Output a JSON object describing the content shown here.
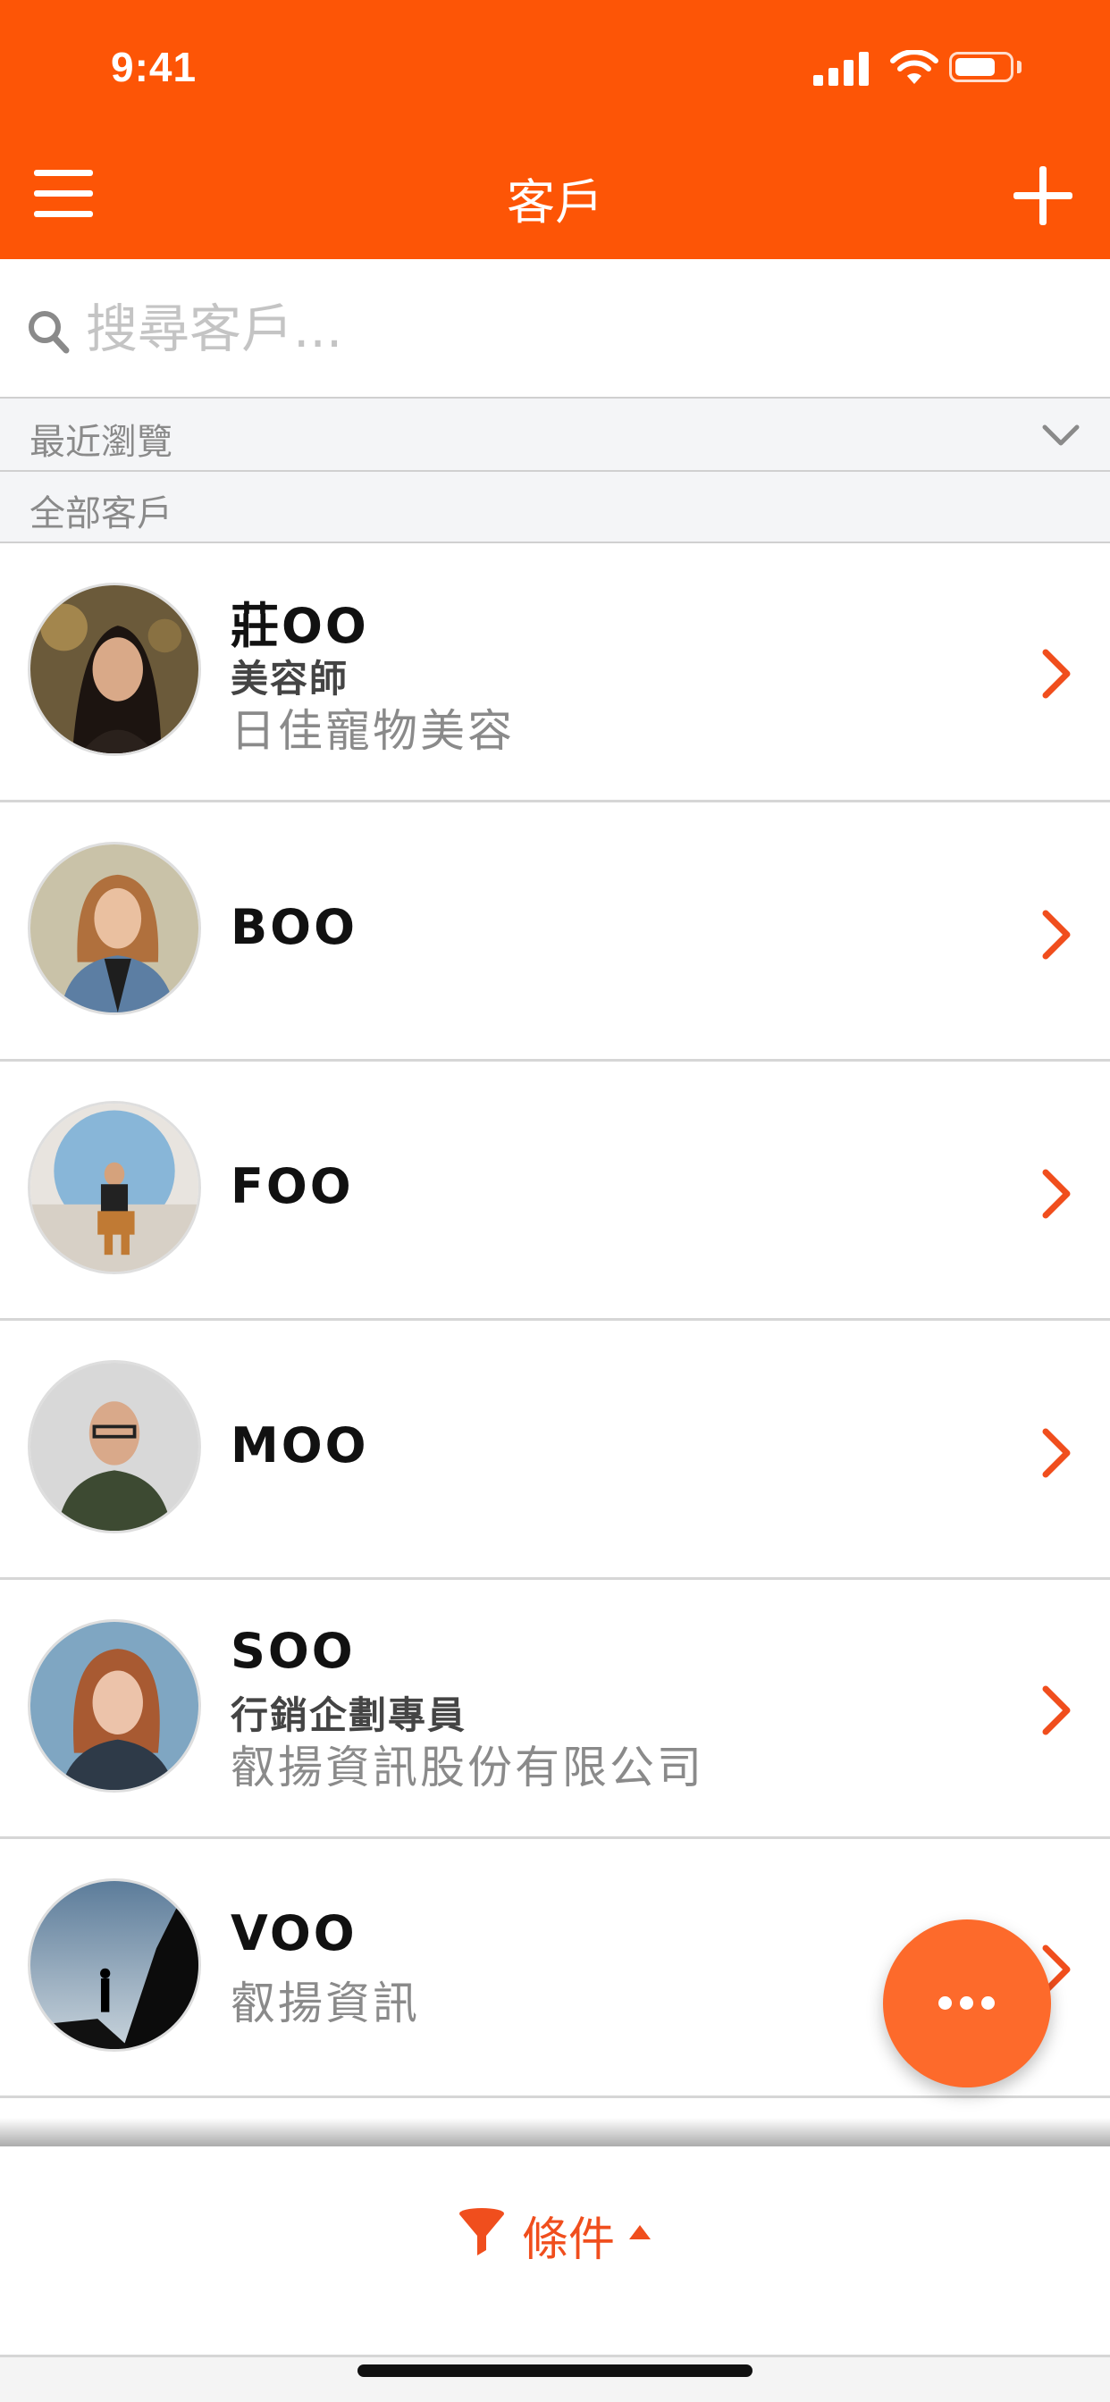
{
  "status_bar": {
    "time": "9:41"
  },
  "header": {
    "title": "客戶",
    "menu_icon": "hamburger-icon",
    "add_icon": "plus-icon"
  },
  "search": {
    "placeholder": "搜尋客戶..."
  },
  "sections": {
    "recent": "最近瀏覽",
    "all": "全部客戶"
  },
  "customers": [
    {
      "name": "莊OO",
      "job_title": "美容師",
      "company": "日佳寵物美容"
    },
    {
      "name": "BOO",
      "job_title": "",
      "company": ""
    },
    {
      "name": "FOO",
      "job_title": "",
      "company": ""
    },
    {
      "name": "MOO",
      "job_title": "",
      "company": ""
    },
    {
      "name": "SOO",
      "job_title": "行銷企劃專員",
      "company": "叡揚資訊股份有限公司"
    },
    {
      "name": "VOO",
      "job_title": "",
      "company": "叡揚資訊"
    }
  ],
  "bottom_bar": {
    "filter_label": "條件"
  },
  "colors": {
    "accent": "#fd5506",
    "chevron": "#f04e1d",
    "fab": "#fd6a2b"
  }
}
